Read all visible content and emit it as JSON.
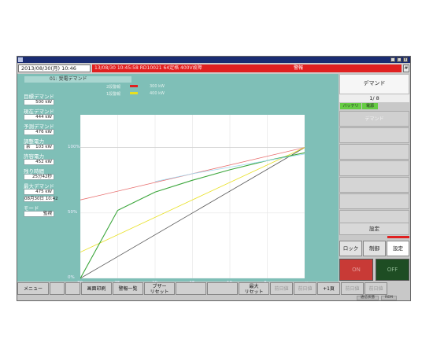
{
  "status": {
    "datetime": "2013/08/30(月) 10:46",
    "alarm_message": "13/08/30 10:45:58 RD10021 64定格 400V故障",
    "alarm_level": "警報",
    "scroll_glyph": "#"
  },
  "window_buttons": [
    "_",
    "□",
    "x"
  ],
  "panel": {
    "name": "01: 受電デマンド",
    "legend": [
      {
        "label": "2段警報",
        "value": "300 kW",
        "color": "#e02020"
      },
      {
        "label": "1段警報",
        "value": "400 kW",
        "color": "#e8e020"
      }
    ],
    "fields": [
      {
        "label": "目標デマンド",
        "value": "500 kW"
      },
      {
        "label": "現在デマンド",
        "value": "444 kW"
      },
      {
        "label": "予測デマンド",
        "value": "476 kW"
      },
      {
        "label": "調整電力",
        "prefix": "余",
        "value": "103 kW"
      },
      {
        "label": "許容電力",
        "value": "452 kW"
      },
      {
        "label": "残り時間",
        "value": "25分42秒"
      },
      {
        "label": "最大デマンド",
        "value": "475 kW",
        "value2": "08月30日 10:42"
      },
      {
        "label": "モード",
        "value": "監視"
      }
    ]
  },
  "chart_data": {
    "type": "line",
    "x_ticks": [
      "30",
      "25",
      "20",
      "15",
      "10",
      "5",
      "0分"
    ],
    "y_ticks": [
      "100%",
      "50%",
      "0%"
    ],
    "xlim": [
      30,
      0
    ],
    "ylim": [
      0,
      125
    ],
    "series": [
      {
        "color": "#555555",
        "x": [
          30,
          0
        ],
        "y": [
          0,
          100
        ]
      },
      {
        "color": "#e87070",
        "x": [
          30,
          0
        ],
        "y": [
          60,
          100
        ]
      },
      {
        "color": "#e8e020",
        "x": [
          30,
          0
        ],
        "y": [
          20,
          100
        ]
      },
      {
        "color": "#3aa63a",
        "x": [
          30,
          25,
          20,
          15,
          10,
          5,
          0
        ],
        "y": [
          0,
          52,
          66,
          75,
          83,
          90,
          96
        ]
      },
      {
        "color": "#9fd8f0",
        "x": [
          20,
          15,
          10,
          5,
          0
        ],
        "y": [
          74,
          80,
          85,
          90,
          95
        ]
      }
    ],
    "target_line": 100
  },
  "right_panel": {
    "title": "デマンド",
    "page": "1/ 8",
    "badges": [
      "バッテリ",
      "電源"
    ],
    "list_first": "デマンド",
    "setting_label": "設定",
    "tabs": [
      "ロック",
      "制御",
      "設定"
    ],
    "on_label": "ON",
    "off_label": "OFF"
  },
  "function_keys": [
    {
      "label": "メニュー"
    },
    {
      "label": ""
    },
    {
      "label": ""
    },
    {
      "label": "画面印刷"
    },
    {
      "label": "警報一覧"
    },
    {
      "label": "ブザー\nリセット"
    },
    {
      "label": ""
    },
    {
      "label": ""
    },
    {
      "label": "最大\nリセット"
    },
    {
      "label": "前日値",
      "disabled": true
    },
    {
      "label": "前日値",
      "disabled": true
    },
    {
      "label": "+1頁"
    },
    {
      "label": "前日値",
      "disabled": true
    },
    {
      "label": "前日値",
      "disabled": true
    }
  ],
  "indicators": [
    "通信状態",
    "REM"
  ]
}
